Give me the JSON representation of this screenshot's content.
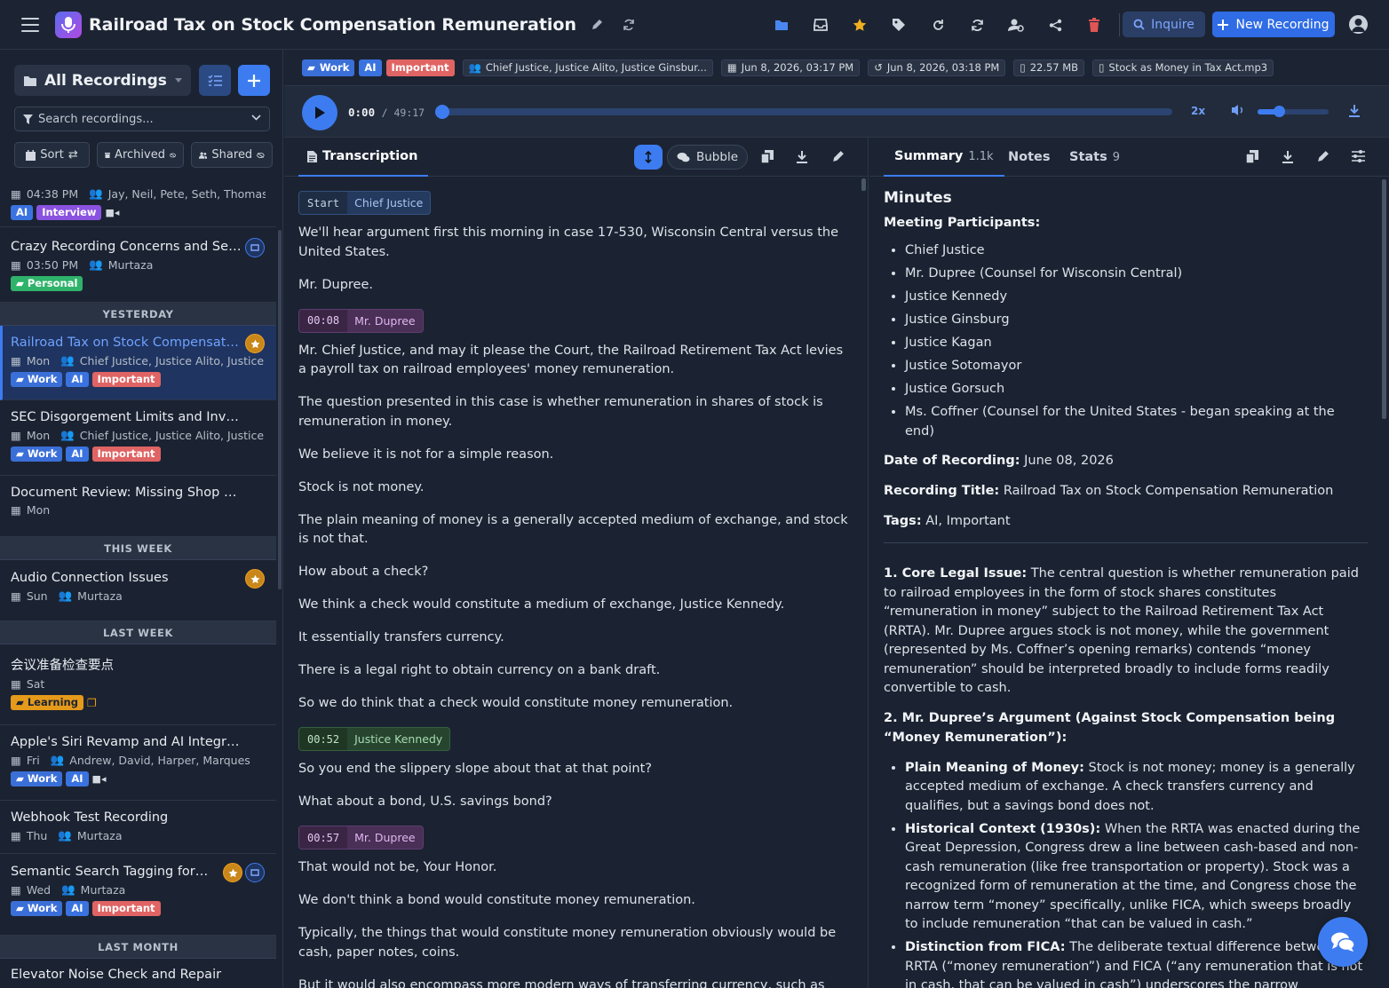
{
  "app": {
    "title": "Railroad Tax on Stock Compensation Remuneration"
  },
  "header": {
    "inquire_label": "Inquire",
    "new_recording_label": "New Recording"
  },
  "sidebar": {
    "filter_label": "All Recordings",
    "search_placeholder": "Search recordings...",
    "sort_label": "Sort",
    "archived_label": "Archived",
    "shared_label": "Shared",
    "items": [
      {
        "time": "04:38 PM",
        "people": "Jay, Neil, Pete, Seth, Thomas",
        "tags": [
          "AI",
          "Interview"
        ]
      },
      {
        "title": "Crazy Recording Concerns and Session Ha",
        "time": "03:50 PM",
        "people": "Murtaza",
        "tags": [
          "Personal"
        ]
      },
      {
        "group": "YESTERDAY"
      },
      {
        "title": "Railroad Tax on Stock Compensation Remuneration",
        "time": "Mon",
        "people": "Chief Justice, Justice Alito, Justice Ginsburg",
        "tags": [
          "Work",
          "AI",
          "Important"
        ]
      },
      {
        "title": "SEC Disgorgement Limits and Investor Protection",
        "time": "Mon",
        "people": "Chief Justice, Justice Alito, Justice Gorsuch",
        "tags": [
          "Work",
          "AI",
          "Important"
        ]
      },
      {
        "title": "Document Review: Missing Shop Numbers",
        "time": "Mon"
      },
      {
        "group": "THIS WEEK"
      },
      {
        "title": "Audio Connection Issues",
        "time": "Sun",
        "people": "Murtaza"
      },
      {
        "group": "LAST WEEK"
      },
      {
        "title": "会议准备检查要点",
        "time": "Sat",
        "tags": [
          "Learning"
        ]
      },
      {
        "title": "Apple's Siri Revamp and AI Integration Plans",
        "time": "Fri",
        "people": "Andrew, David, Harper, Marques",
        "tags": [
          "Work",
          "AI"
        ]
      },
      {
        "title": "Webhook Test Recording",
        "time": "Thu",
        "people": "Murtaza"
      },
      {
        "title": "Semantic Search Tagging for Transcripts",
        "time": "Wed",
        "people": "Murtaza",
        "tags": [
          "Work",
          "AI",
          "Important"
        ]
      },
      {
        "group": "LAST MONTH"
      },
      {
        "title": "Elevator Noise Check and Repair"
      }
    ]
  },
  "metabar": {
    "tags": [
      "Work",
      "AI",
      "Important"
    ],
    "participants": "Chief Justice, Justice Alito, Justice Ginsbur...",
    "created": "Jun 8, 2026, 03:17 PM",
    "modified": "Jun 8, 2026, 03:18 PM",
    "size": "22.57 MB",
    "filename": "Stock as Money in Tax Act.mp3"
  },
  "player": {
    "current": "0:00",
    "duration": "/ 49:17",
    "speed": "2x",
    "progress": 0.0,
    "volume": 0.3
  },
  "transcription": {
    "tab_label": "Transcription",
    "bubble_label": "Bubble",
    "blocks": [
      {
        "time": "Start",
        "speaker": "Chief Justice",
        "paras": [
          "We'll hear argument first this morning in case 17-530, Wisconsin Central versus the United States.",
          "Mr. Dupree."
        ]
      },
      {
        "time": "00:08",
        "speaker": "Mr. Dupree",
        "paras": [
          "Mr. Chief Justice, and may it please the Court, the Railroad Retirement Tax Act levies a payroll tax on railroad employees' money remuneration.",
          "The question presented in this case is whether remuneration in shares of stock is remuneration in money.",
          "We believe it is not for a simple reason.",
          "Stock is not money.",
          "The plain meaning of money is a generally accepted medium of exchange, and stock is not that.",
          "How about a check?",
          "We think a check would constitute a medium of exchange, Justice Kennedy.",
          "It essentially transfers currency.",
          "There is a legal right to obtain currency on a bank draft.",
          "So we do think that a check would constitute money remuneration."
        ]
      },
      {
        "time": "00:52",
        "speaker": "Justice Kennedy",
        "paras": [
          "So you end the slippery slope about that at that point?",
          "What about a bond, U.S. savings bond?"
        ]
      },
      {
        "time": "00:57",
        "speaker": "Mr. Dupree",
        "paras": [
          "That would not be, Your Honor.",
          "We don't think a bond would constitute money remuneration.",
          "Typically, the things that would constitute money remuneration obviously would be cash, paper notes, coins.",
          "But it would also encompass more modern ways of transferring currency, such as direct"
        ]
      }
    ]
  },
  "summary": {
    "tabs": [
      {
        "label": "Summary",
        "count": "1.1k"
      },
      {
        "label": "Notes",
        "count": ""
      },
      {
        "label": "Stats",
        "count": "9"
      }
    ],
    "heading": "Minutes",
    "participants_label": "Meeting Participants:",
    "participants": [
      "Chief Justice",
      "Mr. Dupree (Counsel for Wisconsin Central)",
      "Justice Kennedy",
      "Justice Ginsburg",
      "Justice Kagan",
      "Justice Sotomayor",
      "Justice Gorsuch",
      "Ms. Coffner (Counsel for the United States - began speaking at the end)"
    ],
    "date_label": "Date of Recording:",
    "date_value": "June 08, 2026",
    "title_label": "Recording Title:",
    "title_value": "Railroad Tax on Stock Compensation Remuneration",
    "tags_label": "Tags:",
    "tags_value": "AI, Important",
    "s1_label": "1. Core Legal Issue:",
    "s1_text": "The central question is whether remuneration paid to railroad employees in the form of stock shares constitutes “remuneration in money” subject to the Railroad Retirement Tax Act (RRTA). Mr. Dupree argues stock is not money, while the government (represented by Ms. Coffner’s opening remarks) contends “money remuneration” should be interpreted broadly to include forms readily convertible to cash.",
    "s2_label": "2. Mr. Dupree’s Argument (Against Stock Compensation being “Money Remuneration”):",
    "bullets": [
      {
        "label": "Plain Meaning of Money:",
        "text": "Stock is not money; money is a generally accepted medium of exchange. A check transfers currency and qualifies, but a savings bond does not."
      },
      {
        "label": "Historical Context (1930s):",
        "text": "When the RRTA was enacted during the Great Depression, Congress drew a line between cash-based and non-cash remuneration (like free transportation or property). Stock was a recognized form of remuneration at the time, and Congress chose the narrow term “money” specifically, unlike FICA, which sweeps broadly to include remuneration “that can be valued in cash.”"
      },
      {
        "label": "Distinction from FICA:",
        "text": "The deliberate textual difference between the RRTA (“money remuneration”) and FICA (“any remuneration that is not in cash, that can be valued in cash”) underscores the narrow interpretation of the RRTA."
      }
    ]
  },
  "colors": {
    "accent": "#3d7cf0",
    "work": "#3b6fd8",
    "ai": "#3a73e0",
    "important": "#e06464",
    "interview": "#8a52e0",
    "personal": "#2fb36b",
    "learning": "#e69a1a",
    "star": "#f0a020"
  }
}
